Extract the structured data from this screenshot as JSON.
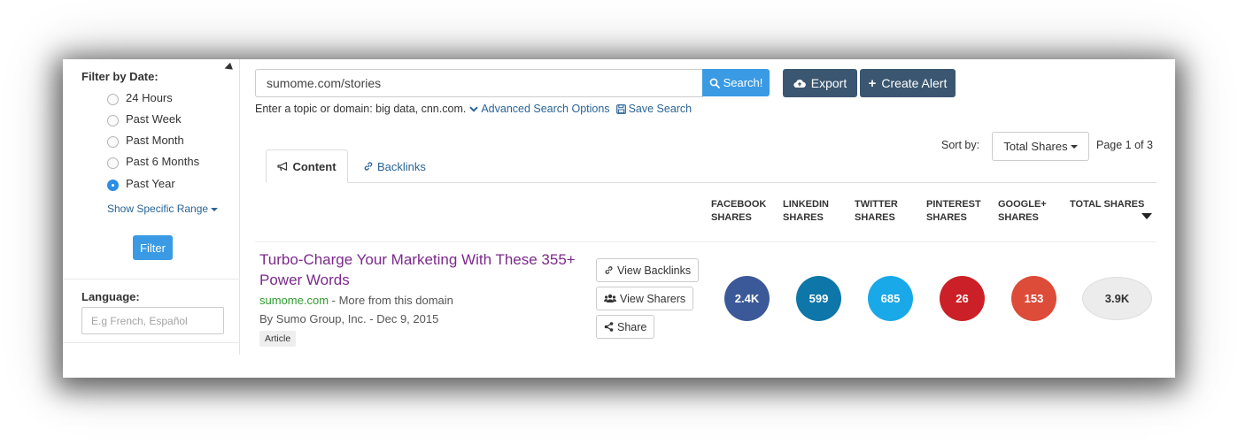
{
  "sidebar": {
    "date_filter_label": "Filter by Date:",
    "date_options": [
      {
        "label": "24 Hours",
        "checked": false
      },
      {
        "label": "Past Week",
        "checked": false
      },
      {
        "label": "Past Month",
        "checked": false
      },
      {
        "label": "Past 6 Months",
        "checked": false
      },
      {
        "label": "Past Year",
        "checked": true
      }
    ],
    "specific_range_label": "Show Specific Range",
    "filter_button_label": "Filter",
    "language_label": "Language:",
    "language_placeholder": "E.g French, Español"
  },
  "search": {
    "query": "sumome.com/stories",
    "button_label": "Search!",
    "hint": "Enter a topic or domain: big data, cnn.com.",
    "advanced_label": "Advanced Search Options",
    "save_label": "Save Search"
  },
  "toolbar": {
    "export_label": "Export",
    "create_alert_label": "Create Alert"
  },
  "sort": {
    "label": "Sort by:",
    "selected": "Total Shares",
    "page_info": "Page 1 of 3"
  },
  "tabs": [
    {
      "label": "Content",
      "active": true
    },
    {
      "label": "Backlinks",
      "active": false
    }
  ],
  "columns": [
    {
      "line1": "FACEBOOK",
      "line2": "SHARES"
    },
    {
      "line1": "LINKEDIN",
      "line2": "SHARES"
    },
    {
      "line1": "TWITTER",
      "line2": "SHARES"
    },
    {
      "line1": "PINTEREST",
      "line2": "SHARES"
    },
    {
      "line1": "GOOGLE+",
      "line2": "SHARES"
    },
    {
      "line1": "TOTAL SHARES",
      "line2": ""
    }
  ],
  "result": {
    "title": "Turbo-Charge Your Marketing With These 355+ Power Words",
    "domain": "sumome.com",
    "domain_suffix": " - More from this domain",
    "byline": "By Sumo Group, Inc. - Dec 9, 2015",
    "badge": "Article",
    "actions": {
      "view_backlinks": "View Backlinks",
      "view_sharers": "View Sharers",
      "share": "Share"
    },
    "shares": {
      "facebook": "2.4K",
      "linkedin": "599",
      "twitter": "685",
      "pinterest": "26",
      "googleplus": "153",
      "total": "3.9K"
    }
  },
  "colors": {
    "primary": "#3a9ae4",
    "dark_button": "#3a5670",
    "link": "#2a6496",
    "title": "#7b2a8a",
    "domain": "#2e9b2e",
    "facebook": "#3b5998",
    "linkedin": "#0e76a8",
    "twitter": "#1aa9e8",
    "pinterest": "#cb2027",
    "googleplus": "#dd4b39"
  }
}
